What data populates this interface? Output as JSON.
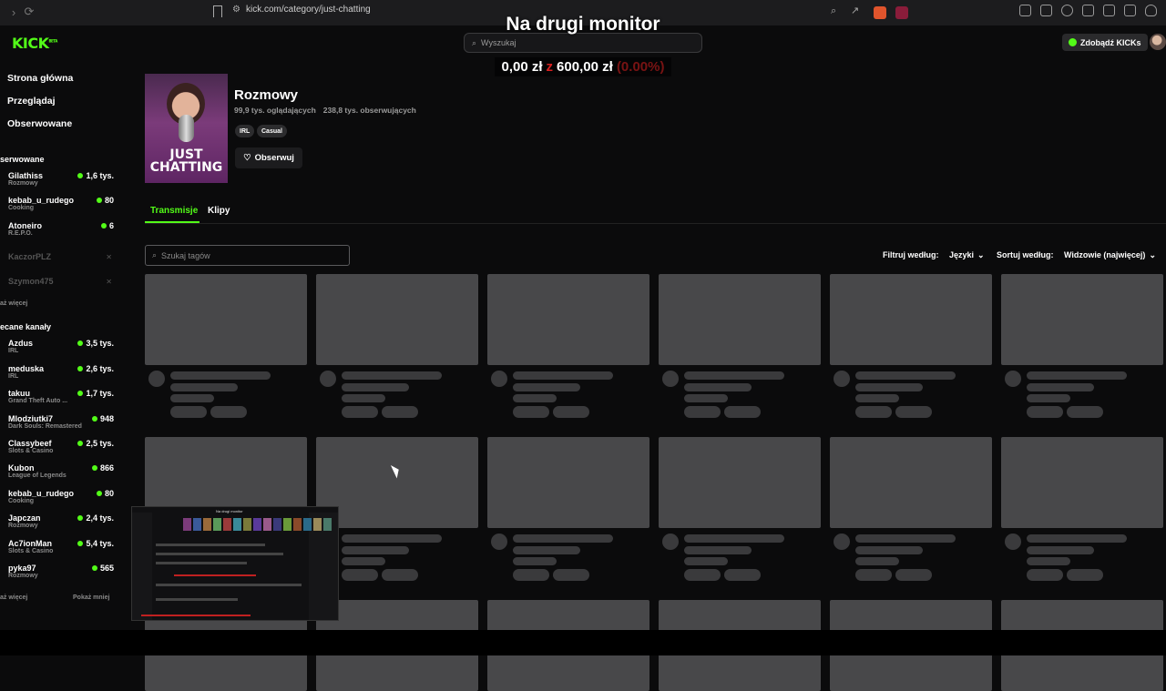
{
  "browser": {
    "url": "kick.com/category/just-chatting"
  },
  "overlay": {
    "title": "Na drugi monitor",
    "current": "0,00 zł",
    "separator": "z",
    "goal": "600,00 zł",
    "percent": "(0.00%)"
  },
  "header": {
    "logo": "KICK",
    "logo_badge": "BETA",
    "search_placeholder": "Wyszukaj",
    "get_kicks": "Zdobądź KICKs"
  },
  "sidebar": {
    "nav": [
      "Strona główna",
      "Przeglądaj",
      "Obserwowane"
    ],
    "followed_title": "serwowane",
    "followed": [
      {
        "name": "Gilathiss",
        "game": "Rozmowy",
        "viewers": "1,6 tys."
      },
      {
        "name": "kebab_u_rudego",
        "game": "Cooking",
        "viewers": "80"
      },
      {
        "name": "Atoneiro",
        "game": "R.E.P.O.",
        "viewers": "6"
      }
    ],
    "offline": [
      "KaczorPLZ",
      "Szymon475"
    ],
    "show_more_followed": "aż więcej",
    "recommended_title": "ecane kanały",
    "recommended": [
      {
        "name": "Azdus",
        "game": "IRL",
        "viewers": "3,5 tys."
      },
      {
        "name": "meduska",
        "game": "IRL",
        "viewers": "2,6 tys."
      },
      {
        "name": "takuu",
        "game": "Grand Theft Auto ...",
        "viewers": "1,7 tys."
      },
      {
        "name": "Mlodziutki7",
        "game": "Dark Souls: Remastered",
        "viewers": "948"
      },
      {
        "name": "Classybeef",
        "game": "Slots & Casino",
        "viewers": "2,5 tys."
      },
      {
        "name": "Kubon",
        "game": "League of Legends",
        "viewers": "866"
      },
      {
        "name": "kebab_u_rudego",
        "game": "Cooking",
        "viewers": "80"
      },
      {
        "name": "Japczan",
        "game": "Rozmowy",
        "viewers": "2,4 tys."
      },
      {
        "name": "Ac7ionMan",
        "game": "Slots & Casino",
        "viewers": "5,4 tys."
      },
      {
        "name": "pyka97",
        "game": "Rozmowy",
        "viewers": "565"
      }
    ],
    "show_more": "aż więcej",
    "show_less": "Pokaż mniej"
  },
  "category": {
    "cover_text": "JUST CHATTING",
    "title": "Rozmowy",
    "viewers": "99,9 tys. oglądających",
    "followers": "238,8 tys. obserwujących",
    "tags": [
      "IRL",
      "Casual"
    ],
    "follow_label": "Obserwuj"
  },
  "tabs": [
    "Transmisje",
    "Klipy"
  ],
  "filters": {
    "tag_search_placeholder": "Szukaj tagów",
    "filter_label": "Filtruj według:",
    "filter_value": "Języki",
    "sort_label": "Sortuj według:",
    "sort_value": "Widzowie (najwięcej)"
  },
  "mini_preview": {
    "title": "Na drugi monitor"
  },
  "colors": {
    "accent": "#53fc18",
    "bg": "#0b0b0c",
    "skeleton": "#48484a",
    "goal_red": "#d82020"
  }
}
